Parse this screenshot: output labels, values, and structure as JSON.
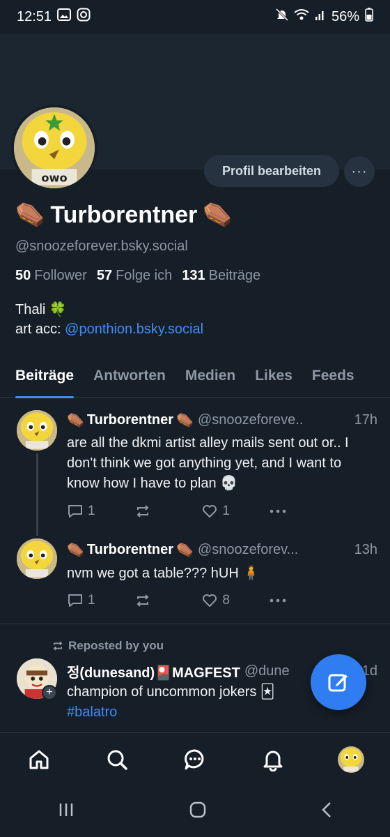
{
  "status_bar": {
    "time": "12:51",
    "battery": "56%",
    "icons": [
      "image-icon",
      "instagram-icon",
      "mute-icon",
      "wifi-icon",
      "signal-icon",
      "battery-icon"
    ]
  },
  "profile": {
    "edit_button": "Profil bearbeiten",
    "more_button": "···",
    "display_name": "Turborentner",
    "name_emoji": "⚰️",
    "handle": "@snoozeforever.bsky.social",
    "stats": {
      "followers_count": "50",
      "followers_label": "Follower",
      "following_count": "57",
      "following_label": "Folge ich",
      "posts_count": "131",
      "posts_label": "Beiträge"
    },
    "bio_line1": "Thali 🍀",
    "bio_prefix": "art acc: ",
    "bio_link": "@ponthion.bsky.social"
  },
  "tabs": [
    "Beiträge",
    "Antworten",
    "Medien",
    "Likes",
    "Feeds"
  ],
  "posts": [
    {
      "name": "Turborentner",
      "handle": "@snoozeforeve..",
      "time": "17h",
      "text": "are all the dkmi artist alley mails sent out or.. I don't think we got anything yet, and I want to know how I have to plan 💀",
      "replies": "1",
      "reposts": "",
      "likes": "1"
    },
    {
      "name": "Turborentner",
      "handle": "@snoozeforev...",
      "time": "13h",
      "text": "nvm we got a table??? hUH 🧍",
      "replies": "1",
      "reposts": "",
      "likes": "8"
    },
    {
      "repost_label": "Reposted by you",
      "name": "정(dunesand)🎴MAGFEST",
      "handle": "@dune",
      "time": "1d",
      "text": "champion of uncommon jokers 🃏",
      "hashtag": "#balatro"
    }
  ],
  "colors": {
    "background": "#161e27",
    "accent": "#3d8ef7",
    "fab": "#2f7df0",
    "muted": "#8b98a5"
  },
  "bottom_nav": [
    "home-icon",
    "search-icon",
    "chat-icon",
    "bell-icon",
    "profile-avatar"
  ],
  "system_nav": [
    "recent-apps-icon",
    "home-button-icon",
    "back-icon"
  ]
}
